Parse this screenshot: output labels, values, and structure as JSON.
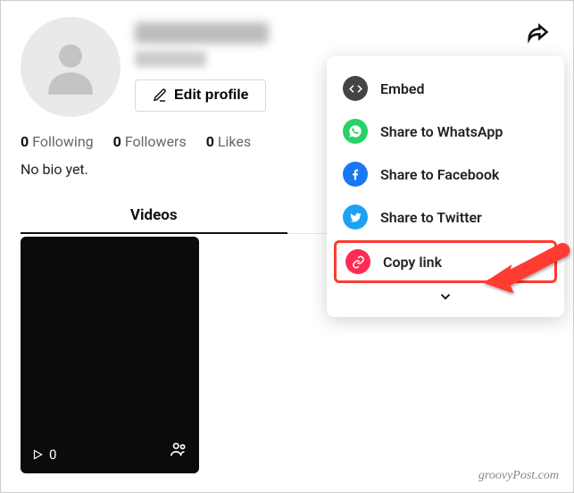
{
  "profile": {
    "username_redacted": true,
    "displayname_redacted": true,
    "edit_profile_label": "Edit profile",
    "bio": "No bio yet."
  },
  "stats": {
    "following_count": "0",
    "following_label": "Following",
    "followers_count": "0",
    "followers_label": "Followers",
    "likes_count": "0",
    "likes_label": "Likes"
  },
  "tabs": {
    "videos": "Videos"
  },
  "video": {
    "views": "0"
  },
  "share_menu": {
    "items": [
      {
        "label": "Embed",
        "icon": "code",
        "bg": "#444"
      },
      {
        "label": "Share to WhatsApp",
        "icon": "whatsapp",
        "bg": "#25D366"
      },
      {
        "label": "Share to Facebook",
        "icon": "facebook",
        "bg": "#1877F2"
      },
      {
        "label": "Share to Twitter",
        "icon": "twitter",
        "bg": "#1DA1F2"
      },
      {
        "label": "Copy link",
        "icon": "link",
        "bg": "#FE2C55",
        "highlighted": true
      }
    ]
  },
  "watermark": "groovyPost.com"
}
